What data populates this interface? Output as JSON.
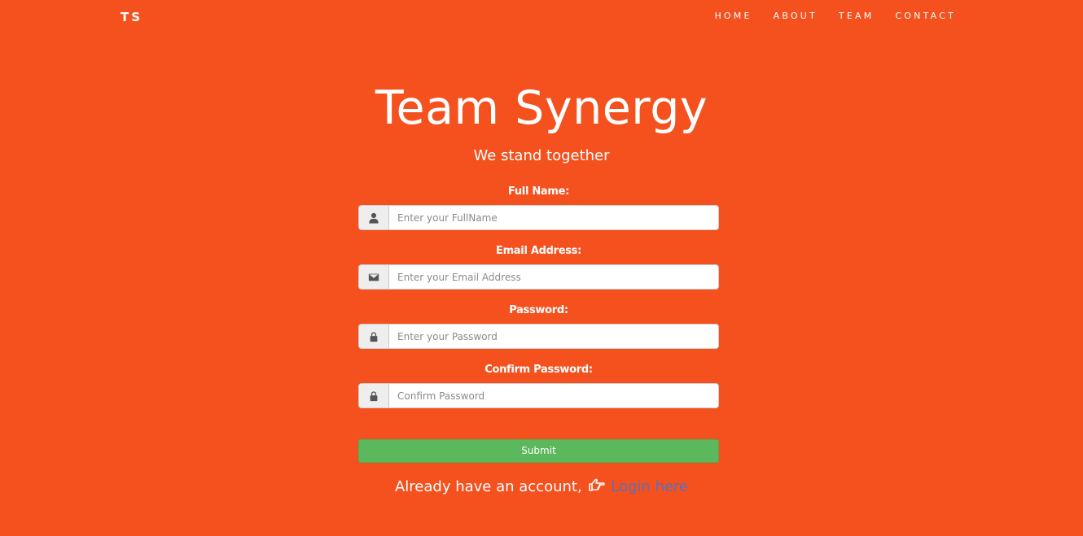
{
  "nav": {
    "brand": "TS",
    "links": [
      "HOME",
      "ABOUT",
      "TEAM",
      "CONTACT"
    ]
  },
  "hero": {
    "title": "Team Synergy",
    "subtitle": "We stand together"
  },
  "form": {
    "fields": [
      {
        "label": "Full Name:",
        "placeholder": "Enter your FullName",
        "icon": "user-icon",
        "value": ""
      },
      {
        "label": "Email Address:",
        "placeholder": "Enter your Email Address",
        "icon": "envelope-icon",
        "value": ""
      },
      {
        "label": "Password:",
        "placeholder": "Enter your Password",
        "icon": "lock-icon",
        "value": ""
      },
      {
        "label": "Confirm Password:",
        "placeholder": "Confirm Password",
        "icon": "lock-icon",
        "value": ""
      }
    ],
    "submit_label": "Submit"
  },
  "login": {
    "prompt": "Already have an account,",
    "link_text": "Login here",
    "icon": "hand-pointing-right-icon"
  },
  "colors": {
    "background": "#f4511e",
    "submit": "#5cb85c",
    "link": "#5b6fb8"
  }
}
